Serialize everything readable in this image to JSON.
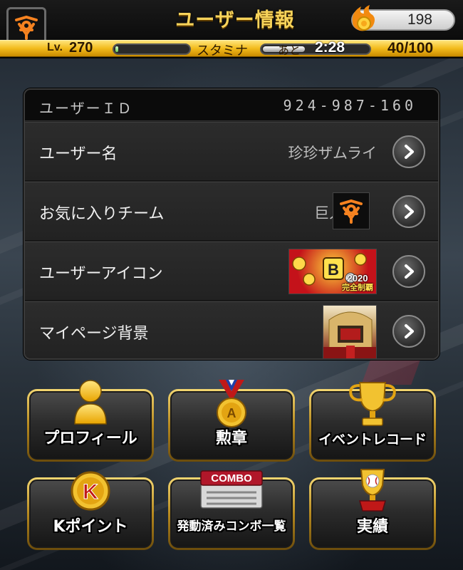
{
  "header": {
    "title": "ユーザー情報",
    "coins": "198",
    "level_prefix": "Lv.",
    "level": "270",
    "exp_progress": 0.04,
    "stamina_label": "スタミナ",
    "recover_prefix": "あと",
    "recover_time": "2:28",
    "stamina": "40/100",
    "stamina_progress": 0.4
  },
  "panel": {
    "user_id_label": "ユーザーＩＤ",
    "user_id_value": "924-987-160",
    "rows": [
      {
        "label": "ユーザー名",
        "value": "珍珍ザムライ"
      },
      {
        "label": "お気に入りチーム",
        "value": "巨人"
      },
      {
        "label": "ユーザーアイコン",
        "value": "",
        "thumb_text": "2020\n完全制覇"
      },
      {
        "label": "マイページ背景",
        "value": ""
      }
    ]
  },
  "thumbs": {
    "icon_text_1": "2020",
    "icon_text_2": "完全制覇"
  },
  "menu": {
    "profile": "プロフィール",
    "medals": "勲章",
    "event_record": "イベントレコード",
    "k_points": "Kポイント",
    "combo_list": "発動済みコンボ一覧",
    "combo_badge": "COMBO",
    "achievements": "実績"
  },
  "colors": {
    "accent_gold": "#f2bb1c",
    "title_gold": "#f7d35a",
    "giants_orange": "#f58220"
  }
}
